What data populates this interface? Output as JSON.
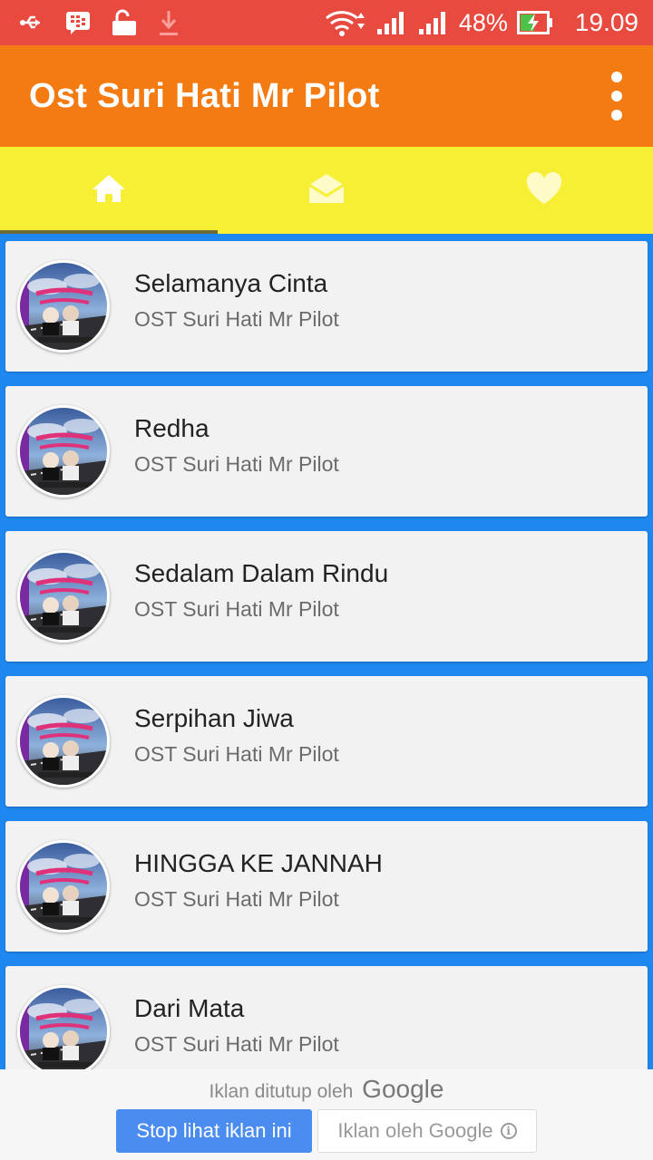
{
  "status_bar": {
    "icons": [
      "usb-icon",
      "bbm-icon",
      "unlock-icon",
      "download-icon",
      "wifi-icon",
      "signal-icon",
      "signal-icon",
      "battery-charging-icon"
    ],
    "battery": "48%",
    "time": "19.09"
  },
  "app_bar": {
    "title": "Ost Suri Hati Mr Pilot",
    "overflow_icon": "more-vert-icon"
  },
  "tabs": [
    {
      "icon": "home-icon",
      "active": true
    },
    {
      "icon": "open-mail-icon",
      "active": false
    },
    {
      "icon": "heart-icon",
      "active": false
    }
  ],
  "songs": [
    {
      "title": "Selamanya Cinta",
      "subtitle": "OST Suri Hati Mr Pilot"
    },
    {
      "title": "Redha",
      "subtitle": "OST Suri Hati Mr Pilot"
    },
    {
      "title": "Sedalam Dalam Rindu",
      "subtitle": "OST Suri Hati Mr Pilot"
    },
    {
      "title": "Serpihan Jiwa",
      "subtitle": "OST Suri Hati Mr Pilot"
    },
    {
      "title": "HINGGA KE JANNAH",
      "subtitle": "OST Suri Hati Mr Pilot"
    },
    {
      "title": "Dari Mata",
      "subtitle": "OST Suri Hati Mr Pilot"
    }
  ],
  "ad": {
    "closed_text": "Iklan ditutup oleh",
    "closed_brand": "Google",
    "stop_label": "Stop lihat iklan ini",
    "by_label": "Iklan oleh Google",
    "info_glyph": "i"
  },
  "colors": {
    "status_bar": "#e84a3f",
    "app_bar": "#f47a12",
    "tab_bar": "#f7ef33",
    "list_bg": "#1e88f0",
    "card_bg": "#f3f2f3"
  }
}
